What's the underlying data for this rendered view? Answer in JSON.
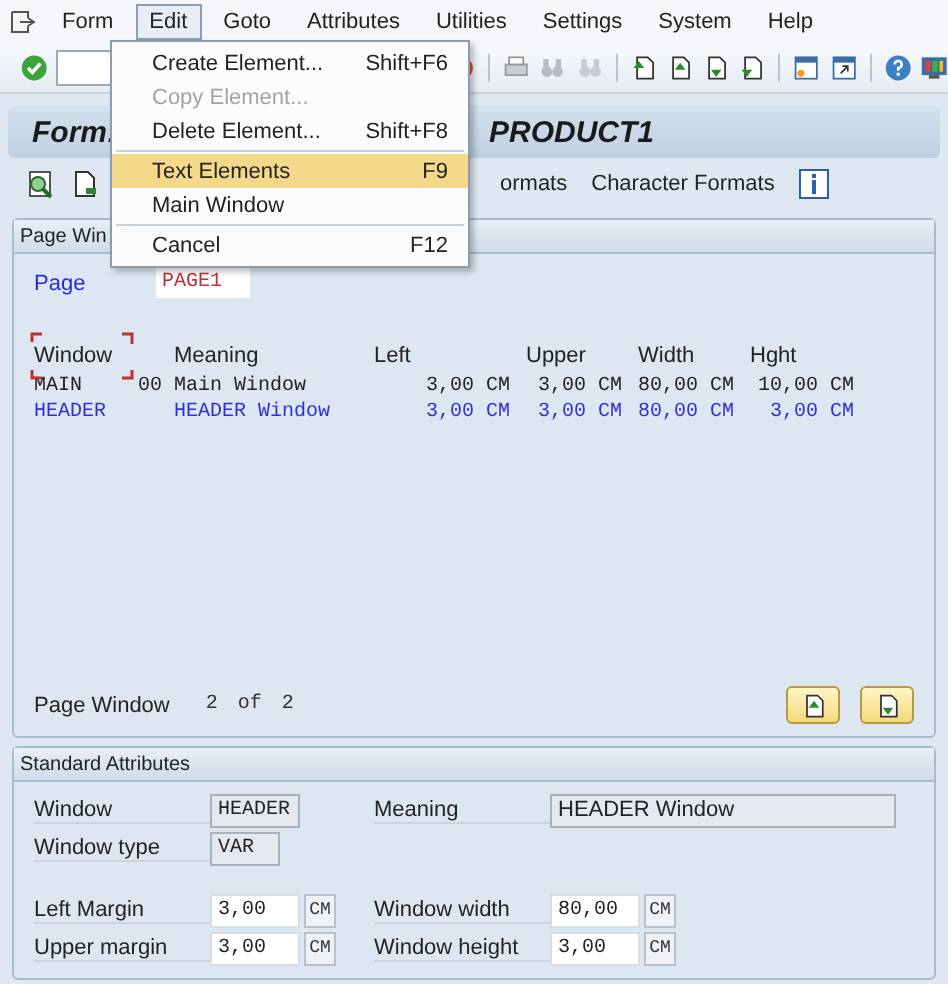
{
  "menu_bar": [
    {
      "label": "Form",
      "selected": false
    },
    {
      "label": "Edit",
      "selected": true
    },
    {
      "label": "Goto",
      "selected": false
    },
    {
      "label": "Attributes",
      "selected": false
    },
    {
      "label": "Utilities",
      "selected": false
    },
    {
      "label": "Settings",
      "selected": false
    },
    {
      "label": "System",
      "selected": false
    },
    {
      "label": "Help",
      "selected": false
    }
  ],
  "edit_menu": [
    {
      "kind": "item",
      "label": "Create Element...",
      "shortcut": "Shift+F6",
      "disabled": false,
      "selected": false
    },
    {
      "kind": "item",
      "label": "Copy Element...",
      "disabled": true,
      "selected": false
    },
    {
      "kind": "item",
      "label": "Delete Element...",
      "shortcut": "Shift+F8",
      "disabled": false,
      "selected": false
    },
    {
      "kind": "separator"
    },
    {
      "kind": "item",
      "label": "Text Elements",
      "shortcut": "F9",
      "disabled": false,
      "selected": true
    },
    {
      "kind": "item",
      "label": "Main Window",
      "disabled": false,
      "selected": false
    },
    {
      "kind": "separator"
    },
    {
      "kind": "item",
      "label": "Cancel",
      "shortcut": "F12",
      "disabled": false,
      "selected": false
    }
  ],
  "form_title": {
    "prefix": "Form:",
    "name": "PRODUCT1"
  },
  "app_toolbar": {
    "partial_label": "ormats",
    "label": "Character Formats"
  },
  "page_window": {
    "title": "Page Win",
    "page_label": "Page",
    "page_value": "PAGE1",
    "columns": [
      "Window",
      "Meaning",
      "Left",
      "Upper",
      "Width",
      "Hght"
    ],
    "rows": [
      {
        "window": "MAIN",
        "code": "00",
        "meaning": "Main Window",
        "left": "3,00 CM",
        "upper": "3,00 CM",
        "width": "80,00 CM",
        "height": "10,00 CM",
        "selected": false
      },
      {
        "window": "HEADER",
        "meaning": "HEADER Window",
        "left": "3,00 CM",
        "upper": "3,00 CM",
        "width": "80,00 CM",
        "height": "3,00 CM",
        "selected": true
      }
    ],
    "pager": {
      "label": "Page Window",
      "current": "2",
      "of": "of",
      "total": "2"
    }
  },
  "standard_attributes": {
    "title": "Standard Attributes",
    "rows": [
      [
        {
          "label": "Window",
          "value": "HEADER",
          "editable": false
        },
        {
          "label": "Meaning",
          "value": "HEADER Window",
          "editable": false
        }
      ],
      [
        {
          "label": "Window type",
          "value": "VAR",
          "editable": false
        }
      ],
      [
        {
          "label": "Left Margin",
          "value": "3,00",
          "unit": "CM",
          "editable": true
        },
        {
          "label": "Window width",
          "value": "80,00",
          "unit": "CM",
          "editable": true
        }
      ],
      [
        {
          "label": "Upper margin",
          "value": "3,00",
          "unit": "CM",
          "editable": true
        },
        {
          "label": "Window height",
          "value": "3,00",
          "unit": "CM",
          "editable": true
        }
      ]
    ]
  }
}
